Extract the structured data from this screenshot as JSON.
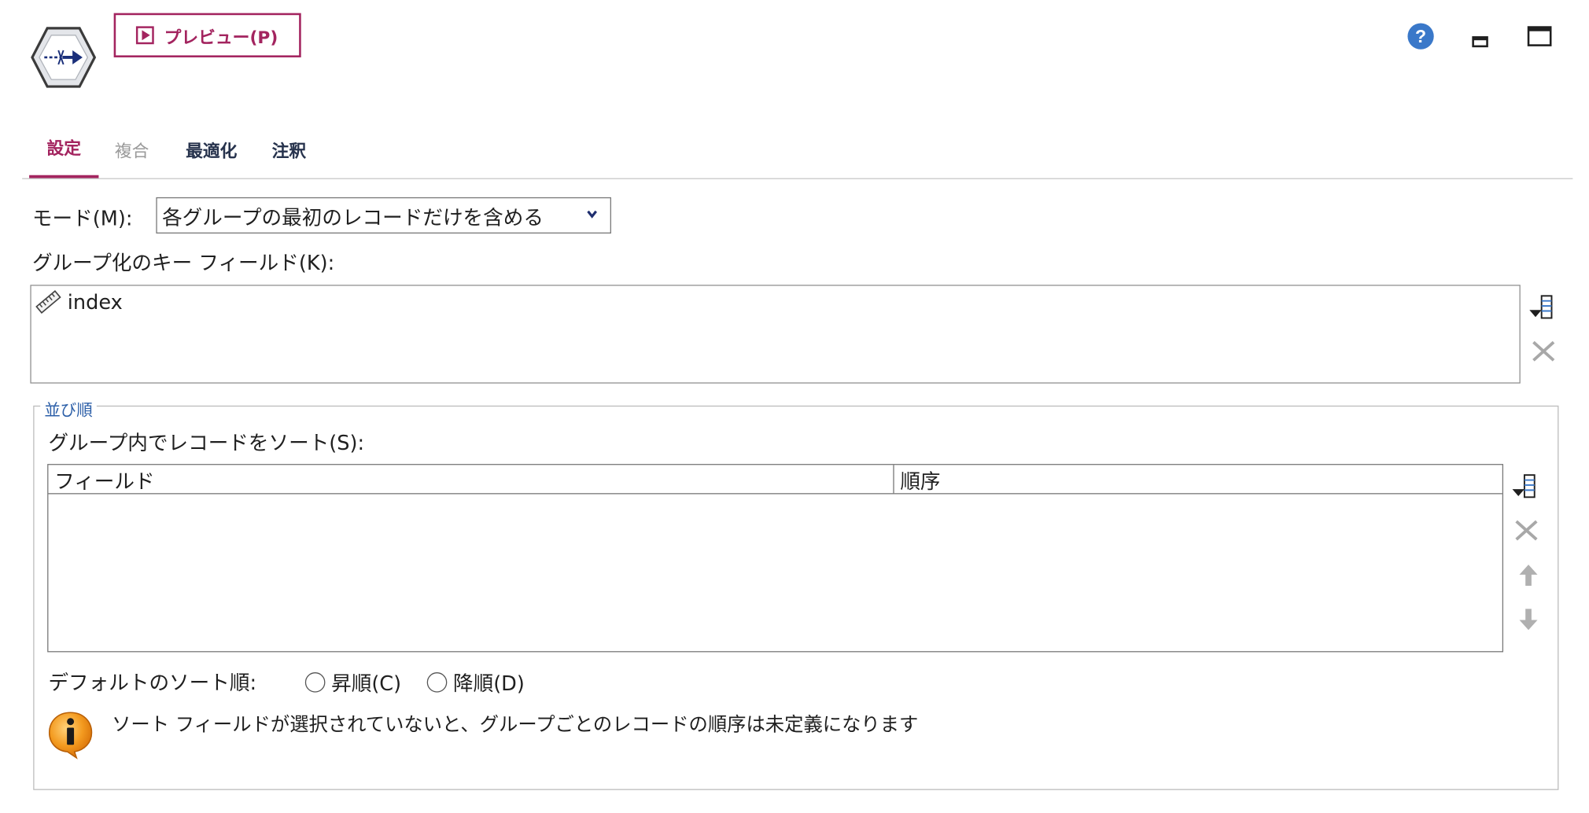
{
  "header": {
    "node_icon": "merge-node-hexagon-icon",
    "preview_label": "プレビュー(P)",
    "help_icon": "help-icon",
    "minimize_icon": "minimize-icon",
    "maximize_icon": "maximize-icon"
  },
  "tabs": [
    {
      "label": "設定",
      "active": true
    },
    {
      "label": "複合",
      "disabled": true
    },
    {
      "label": "最適化"
    },
    {
      "label": "注釈"
    }
  ],
  "mode": {
    "label": "モード(M):",
    "selected": "各グループの最初のレコードだけを含める"
  },
  "key_fields": {
    "label": "グループ化のキー フィールド(K):",
    "items": [
      {
        "name": "index",
        "icon": "continuous-ruler-icon"
      }
    ]
  },
  "sort_group": {
    "legend": "並び順",
    "within_label": "グループ内でレコードをソート(S):",
    "columns": [
      "フィールド",
      "順序"
    ],
    "rows": [],
    "default_sort_label": "デフォルトのソート順:",
    "ascending_label": "昇順(C)",
    "descending_label": "降順(D)",
    "info_text": "ソート フィールドが選択されていないと、グループごとのレコードの順序は未定義になります"
  },
  "colors": {
    "accent": "#a3245f",
    "tab_text": "#27334d",
    "legend_blue": "#2c5fa8",
    "help_blue": "#3a78c9"
  }
}
